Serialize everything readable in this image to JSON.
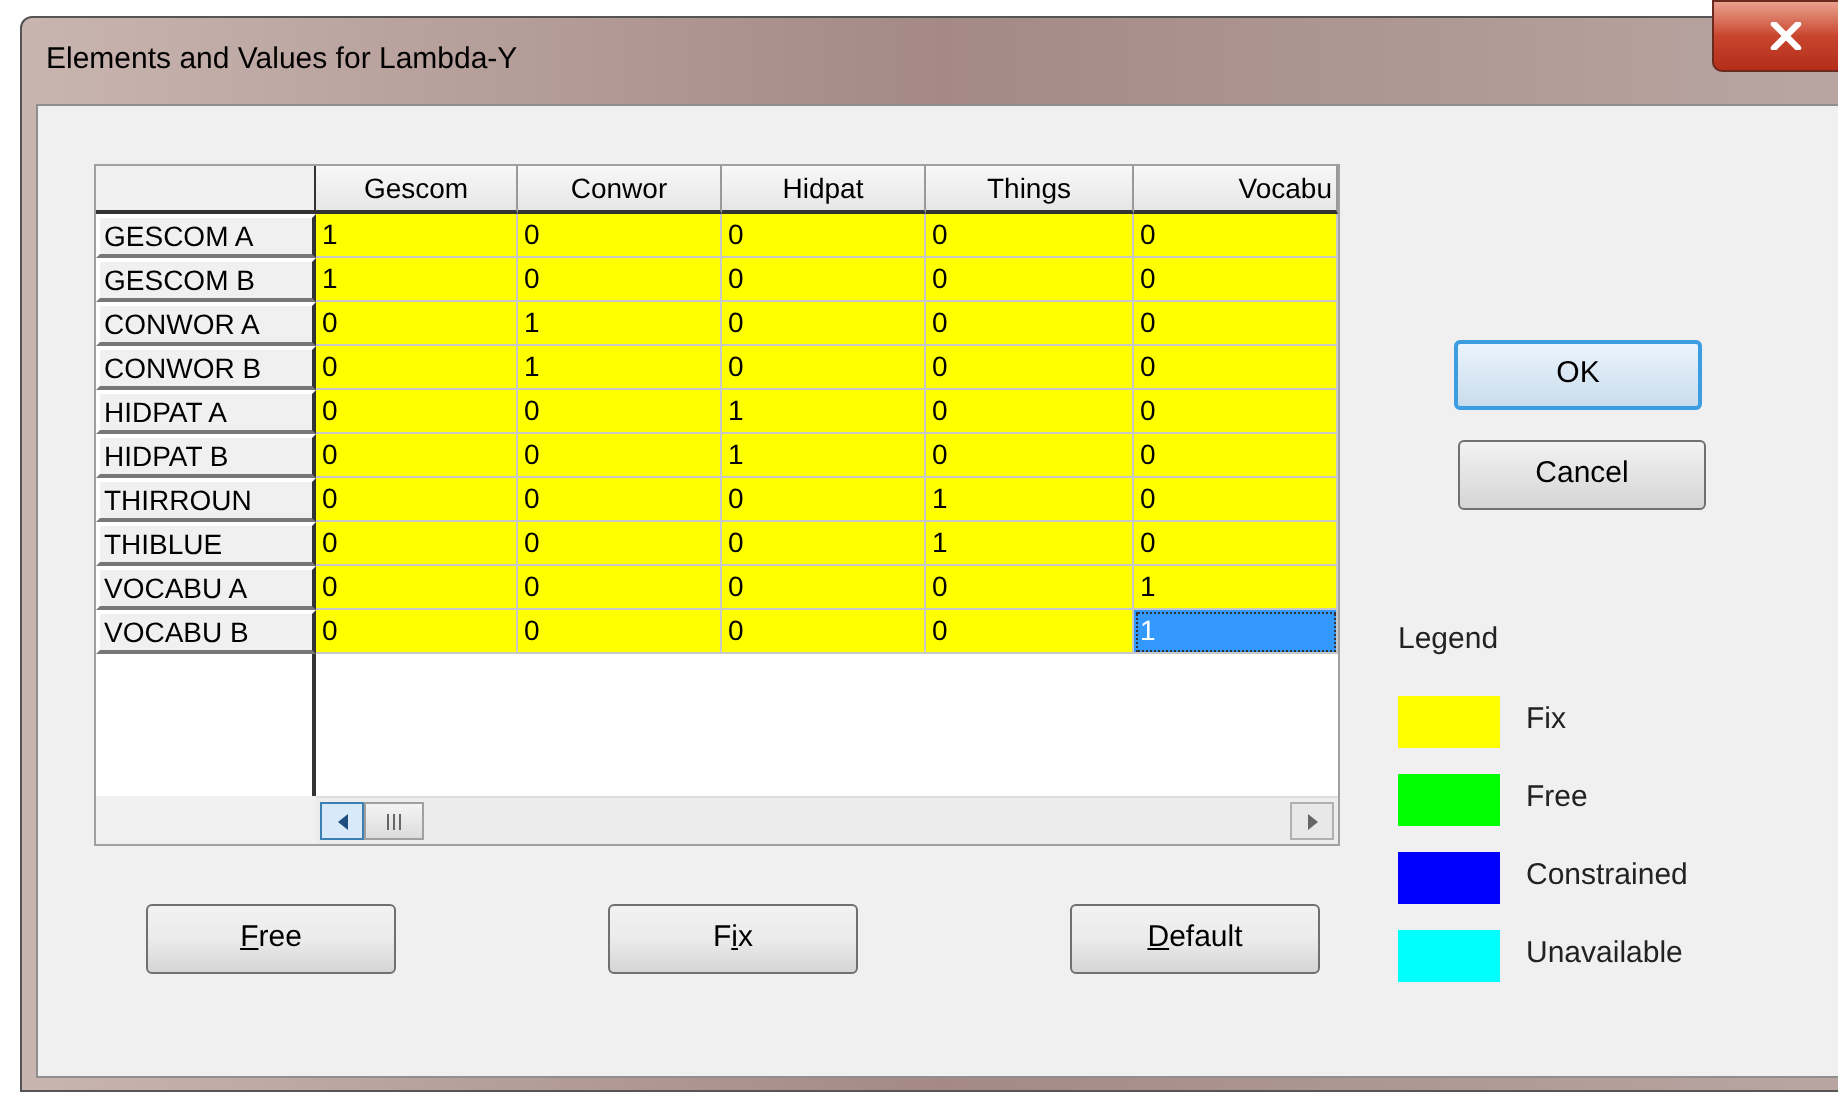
{
  "window": {
    "title": "Elements and Values for Lambda-Y"
  },
  "grid": {
    "columns": [
      "Gescom",
      "Conwor",
      "Hidpat",
      "Things",
      "Vocabu"
    ],
    "rows": [
      {
        "label": "GESCOM A",
        "cells": [
          {
            "value": "1",
            "color": "#ffff00",
            "selected": false
          },
          {
            "value": "0",
            "color": "#ffff00",
            "selected": false
          },
          {
            "value": "0",
            "color": "#ffff00",
            "selected": false
          },
          {
            "value": "0",
            "color": "#ffff00",
            "selected": false
          },
          {
            "value": "0",
            "color": "#ffff00",
            "selected": false
          }
        ]
      },
      {
        "label": "GESCOM B",
        "cells": [
          {
            "value": "1",
            "color": "#ffff00",
            "selected": false
          },
          {
            "value": "0",
            "color": "#ffff00",
            "selected": false
          },
          {
            "value": "0",
            "color": "#ffff00",
            "selected": false
          },
          {
            "value": "0",
            "color": "#ffff00",
            "selected": false
          },
          {
            "value": "0",
            "color": "#ffff00",
            "selected": false
          }
        ]
      },
      {
        "label": "CONWOR A",
        "cells": [
          {
            "value": "0",
            "color": "#ffff00",
            "selected": false
          },
          {
            "value": "1",
            "color": "#ffff00",
            "selected": false
          },
          {
            "value": "0",
            "color": "#ffff00",
            "selected": false
          },
          {
            "value": "0",
            "color": "#ffff00",
            "selected": false
          },
          {
            "value": "0",
            "color": "#ffff00",
            "selected": false
          }
        ]
      },
      {
        "label": "CONWOR B",
        "cells": [
          {
            "value": "0",
            "color": "#ffff00",
            "selected": false
          },
          {
            "value": "1",
            "color": "#ffff00",
            "selected": false
          },
          {
            "value": "0",
            "color": "#ffff00",
            "selected": false
          },
          {
            "value": "0",
            "color": "#ffff00",
            "selected": false
          },
          {
            "value": "0",
            "color": "#ffff00",
            "selected": false
          }
        ]
      },
      {
        "label": "HIDPAT A",
        "cells": [
          {
            "value": "0",
            "color": "#ffff00",
            "selected": false
          },
          {
            "value": "0",
            "color": "#ffff00",
            "selected": false
          },
          {
            "value": "1",
            "color": "#ffff00",
            "selected": false
          },
          {
            "value": "0",
            "color": "#ffff00",
            "selected": false
          },
          {
            "value": "0",
            "color": "#ffff00",
            "selected": false
          }
        ]
      },
      {
        "label": "HIDPAT B",
        "cells": [
          {
            "value": "0",
            "color": "#ffff00",
            "selected": false
          },
          {
            "value": "0",
            "color": "#ffff00",
            "selected": false
          },
          {
            "value": "1",
            "color": "#ffff00",
            "selected": false
          },
          {
            "value": "0",
            "color": "#ffff00",
            "selected": false
          },
          {
            "value": "0",
            "color": "#ffff00",
            "selected": false
          }
        ]
      },
      {
        "label": "THIRROUN",
        "cells": [
          {
            "value": "0",
            "color": "#ffff00",
            "selected": false
          },
          {
            "value": "0",
            "color": "#ffff00",
            "selected": false
          },
          {
            "value": "0",
            "color": "#ffff00",
            "selected": false
          },
          {
            "value": "1",
            "color": "#ffff00",
            "selected": false
          },
          {
            "value": "0",
            "color": "#ffff00",
            "selected": false
          }
        ]
      },
      {
        "label": "THIBLUE",
        "cells": [
          {
            "value": "0",
            "color": "#ffff00",
            "selected": false
          },
          {
            "value": "0",
            "color": "#ffff00",
            "selected": false
          },
          {
            "value": "0",
            "color": "#ffff00",
            "selected": false
          },
          {
            "value": "1",
            "color": "#ffff00",
            "selected": false
          },
          {
            "value": "0",
            "color": "#ffff00",
            "selected": false
          }
        ]
      },
      {
        "label": "VOCABU A",
        "cells": [
          {
            "value": "0",
            "color": "#ffff00",
            "selected": false
          },
          {
            "value": "0",
            "color": "#ffff00",
            "selected": false
          },
          {
            "value": "0",
            "color": "#ffff00",
            "selected": false
          },
          {
            "value": "0",
            "color": "#ffff00",
            "selected": false
          },
          {
            "value": "1",
            "color": "#ffff00",
            "selected": false
          }
        ]
      },
      {
        "label": "VOCABU B",
        "cells": [
          {
            "value": "0",
            "color": "#ffff00",
            "selected": false
          },
          {
            "value": "0",
            "color": "#ffff00",
            "selected": false
          },
          {
            "value": "0",
            "color": "#ffff00",
            "selected": false
          },
          {
            "value": "0",
            "color": "#ffff00",
            "selected": false
          },
          {
            "value": "1",
            "color": "#3399ff",
            "selected": true
          }
        ]
      }
    ]
  },
  "action_buttons": [
    {
      "label_parts": [
        {
          "text": "F",
          "underlined": true
        },
        {
          "text": "ree",
          "underlined": false
        }
      ]
    },
    {
      "label_parts": [
        {
          "text": "F",
          "underlined": false
        },
        {
          "text": "i",
          "underlined": true
        },
        {
          "text": "x",
          "underlined": false
        }
      ]
    },
    {
      "label_parts": [
        {
          "text": "D",
          "underlined": true
        },
        {
          "text": "efault",
          "underlined": false
        }
      ]
    }
  ],
  "dialog_buttons": [
    {
      "label": "OK",
      "default": true
    },
    {
      "label": "Cancel",
      "default": false
    }
  ],
  "legend": {
    "title": "Legend",
    "items": [
      {
        "label": "Fix",
        "color": "#ffff00"
      },
      {
        "label": "Free",
        "color": "#00ff00"
      },
      {
        "label": "Constrained",
        "color": "#0000ff"
      },
      {
        "label": "Unavailable",
        "color": "#00ffff"
      }
    ]
  }
}
